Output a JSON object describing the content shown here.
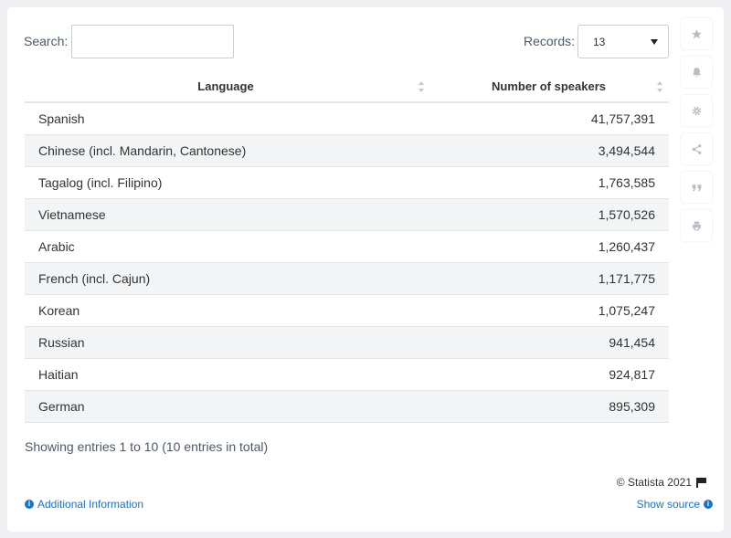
{
  "search": {
    "label": "Search:",
    "value": ""
  },
  "records": {
    "label": "Records:",
    "value": "13"
  },
  "table": {
    "headers": [
      "Language",
      "Number of speakers"
    ]
  },
  "chart_data": {
    "type": "table",
    "columns": [
      "Language",
      "Number of speakers"
    ],
    "rows": [
      [
        "Spanish",
        "41,757,391"
      ],
      [
        "Chinese (incl. Mandarin, Cantonese)",
        "3,494,544"
      ],
      [
        "Tagalog (incl. Filipino)",
        "1,763,585"
      ],
      [
        "Vietnamese",
        "1,570,526"
      ],
      [
        "Arabic",
        "1,260,437"
      ],
      [
        "French (incl. Cajun)",
        "1,171,775"
      ],
      [
        "Korean",
        "1,075,247"
      ],
      [
        "Russian",
        "941,454"
      ],
      [
        "Haitian",
        "924,817"
      ],
      [
        "German",
        "895,309"
      ]
    ]
  },
  "footer": {
    "entries": "Showing entries 1 to 10 (10 entries in total)",
    "copyright": "© Statista 2021",
    "additional_info": "Additional Information",
    "show_source": "Show source"
  },
  "icons": [
    "star-icon",
    "bell-icon",
    "gear-icon",
    "share-icon",
    "quote-icon",
    "print-icon"
  ],
  "colors": {
    "link": "#1a73c7",
    "stripe": "#f2f4f6",
    "text": "#333333"
  }
}
